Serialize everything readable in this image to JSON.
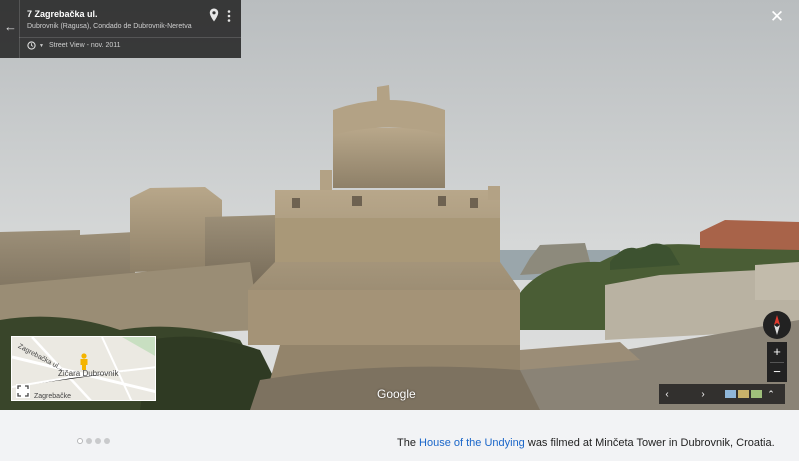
{
  "streetview": {
    "address_title": "7 Zagrebačka ul.",
    "address_subtitle": "Dubrovnik (Ragusa), Condado de Dubrovnik-Neretva",
    "history_label": "Street View - nov. 2011",
    "google_label": "Google"
  },
  "minimap": {
    "street_label": "Zagrebačka ul.",
    "place_label": "Žičara Dubrovnik",
    "street_label_2": "Zagrebačke"
  },
  "controls": {
    "zoom_in": "+",
    "zoom_out": "−",
    "close": "✕",
    "back": "←",
    "prev": "‹",
    "next": "›",
    "expand": "⌃"
  },
  "caption": {
    "prefix": "The ",
    "link_text": "House of the Undying",
    "suffix": " was filmed at Minčeta Tower in Dubrovnik, Croatia."
  },
  "carousel": {
    "active_index": 0,
    "count": 4
  },
  "colors": {
    "link": "#1a66c9",
    "card_bg": "#222222",
    "caption_bg": "#f2f3f5"
  }
}
